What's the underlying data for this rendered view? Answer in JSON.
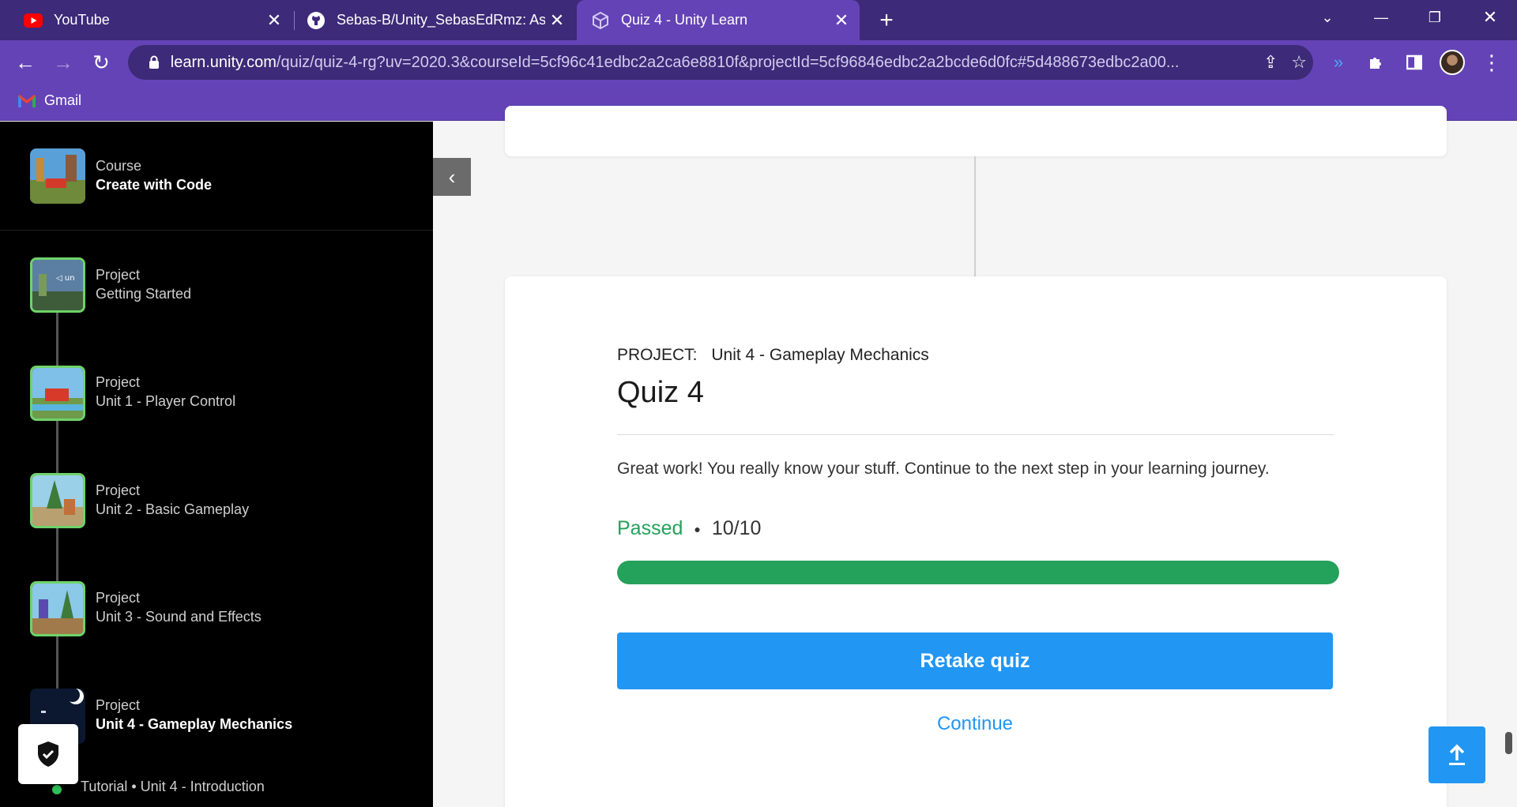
{
  "browser": {
    "tabs": [
      {
        "title": "YouTube",
        "icon": "youtube-icon",
        "active": false
      },
      {
        "title": "Sebas-B/Unity_SebasEdRmz: Assets",
        "icon": "github-icon",
        "active": false
      },
      {
        "title": "Quiz 4 - Unity Learn",
        "icon": "unity-icon",
        "active": true
      }
    ],
    "url_host": "learn.unity.com",
    "url_path": "/quiz/quiz-4-rg?uv=2020.3&courseId=5cf96c41edbc2a2ca6e8810f&projectId=5cf96846edbc2a2bcde6d0fc#5d488673edbc2a00...",
    "bookmarks": [
      {
        "label": "Gmail",
        "icon": "gmail-icon"
      }
    ],
    "accent": "#6443b6",
    "tabbar_color": "#3d2a78"
  },
  "sidebar": {
    "course": {
      "kind": "Course",
      "name": "Create with Code"
    },
    "items": [
      {
        "kind": "Project",
        "name": "Getting Started"
      },
      {
        "kind": "Project",
        "name": "Unit 1 - Player Control"
      },
      {
        "kind": "Project",
        "name": "Unit 2 - Basic Gameplay"
      },
      {
        "kind": "Project",
        "name": "Unit 3 - Sound and Effects"
      },
      {
        "kind": "Project",
        "name": "Unit 4 - Gameplay Mechanics"
      }
    ],
    "tutorial": "Tutorial • Unit 4 - Introduction"
  },
  "quiz": {
    "project_label": "PROJECT:",
    "project_name": "Unit 4 - Gameplay Mechanics",
    "title": "Quiz 4",
    "message": "Great work! You really know your stuff. Continue to the next step in your learning journey.",
    "status": "Passed",
    "score": "10/10",
    "progress": 1.0,
    "retake_label": "Retake quiz",
    "continue_label": "Continue",
    "success_color": "#24a15a",
    "primary_color": "#2196f3"
  }
}
